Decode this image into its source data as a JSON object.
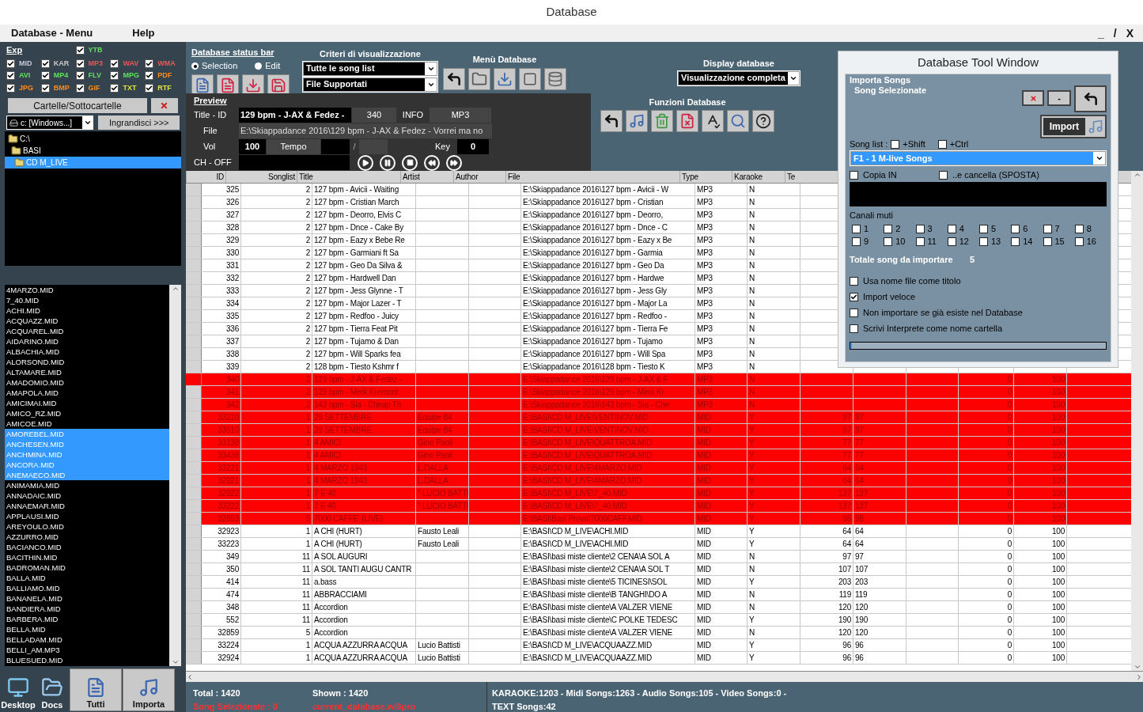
{
  "window": {
    "title": "Database",
    "controls": [
      "_",
      "/",
      "X"
    ]
  },
  "menu": [
    "Database - Menu",
    "Help"
  ],
  "formats": {
    "link": "Exp",
    "items": [
      {
        "label": "YTB",
        "color": "#5fe05f",
        "checked": true
      },
      {
        "label": "MID",
        "color": "#c8c8dc",
        "checked": true
      },
      {
        "label": "KAR",
        "color": "#c8c8c8",
        "checked": true
      },
      {
        "label": "MP3",
        "color": "#e85858",
        "checked": true
      },
      {
        "label": "WAV",
        "color": "#e85858",
        "checked": true
      },
      {
        "label": "WMA",
        "color": "#e85858",
        "checked": true
      },
      {
        "label": "AVI",
        "color": "#5fe05f",
        "checked": true
      },
      {
        "label": "MP4",
        "color": "#5fe05f",
        "checked": true
      },
      {
        "label": "FLV",
        "color": "#5fe05f",
        "checked": true
      },
      {
        "label": "MPG",
        "color": "#5fe05f",
        "checked": true
      },
      {
        "label": "PDF",
        "color": "#ff8c1a",
        "checked": true
      },
      {
        "label": "JPG",
        "color": "#ff8c1a",
        "checked": true
      },
      {
        "label": "BMP",
        "color": "#ff8c1a",
        "checked": true
      },
      {
        "label": "GIF",
        "color": "#ff8c1a",
        "checked": true
      },
      {
        "label": "TXT",
        "color": "#e0e040",
        "checked": true
      },
      {
        "label": "RTF",
        "color": "#e0e040",
        "checked": true
      }
    ]
  },
  "folders_button": "Cartelle/Sottocartelle",
  "drive": "c: [Windows...]",
  "enlarge_button": "Ingrandisci >>>",
  "tree": [
    {
      "label": "C:\\",
      "selected": false,
      "children": [
        {
          "label": "BASI",
          "selected": false,
          "children": [
            {
              "label": "CD M_LIVE",
              "selected": true
            }
          ]
        }
      ]
    }
  ],
  "files": [
    {
      "name": "4MARZO.MID",
      "selected": false
    },
    {
      "name": "7_40.MID",
      "selected": false
    },
    {
      "name": "ACHI.MID",
      "selected": false
    },
    {
      "name": "ACQUAZZ.MID",
      "selected": false
    },
    {
      "name": "ACQUAREL.MID",
      "selected": false
    },
    {
      "name": "AIDARINO.MID",
      "selected": false
    },
    {
      "name": "ALBACHIA.MID",
      "selected": false
    },
    {
      "name": "ALORSOND.MID",
      "selected": false
    },
    {
      "name": "ALTAMARE.MID",
      "selected": false
    },
    {
      "name": "AMADOMIO.MID",
      "selected": false
    },
    {
      "name": "AMAPOLA.MID",
      "selected": false
    },
    {
      "name": "AMICIMAI.MID",
      "selected": false
    },
    {
      "name": "AMICO_RZ.MID",
      "selected": false
    },
    {
      "name": "AMICOE.MID",
      "selected": false
    },
    {
      "name": "AMOREBEL.MID",
      "selected": true
    },
    {
      "name": "ANCHESEN.MID",
      "selected": true
    },
    {
      "name": "ANCHMINA.MID",
      "selected": true
    },
    {
      "name": "ANCORA.MID",
      "selected": true
    },
    {
      "name": "ANEMAECO.MID",
      "selected": true
    },
    {
      "name": "ANIMAMIA.MID",
      "selected": false
    },
    {
      "name": "ANNADAIC.MID",
      "selected": false
    },
    {
      "name": "ANNAEMAR.MID",
      "selected": false
    },
    {
      "name": "APPLAUSI.MID",
      "selected": false
    },
    {
      "name": "AREYOULO.MID",
      "selected": false
    },
    {
      "name": "AZZURRO.MID",
      "selected": false
    },
    {
      "name": "BACIANCO.MID",
      "selected": false
    },
    {
      "name": "BACITHIN.MID",
      "selected": false
    },
    {
      "name": "BADROMAN.MID",
      "selected": false
    },
    {
      "name": "BALLA.MID",
      "selected": false
    },
    {
      "name": "BALLIAMO.MID",
      "selected": false
    },
    {
      "name": "BANANELA.MID",
      "selected": false
    },
    {
      "name": "BANDIERA.MID",
      "selected": false
    },
    {
      "name": "BARBERA.MID",
      "selected": false
    },
    {
      "name": "BELLA.MID",
      "selected": false
    },
    {
      "name": "BELLADAM.MID",
      "selected": false
    },
    {
      "name": "BELLI_AM.MP3",
      "selected": false
    },
    {
      "name": "BLUESUED.MID",
      "selected": false
    }
  ],
  "bottom_buttons": [
    {
      "label": "Desktop",
      "kind": "desktop"
    },
    {
      "label": "Docs",
      "kind": "docs"
    },
    {
      "label": "Tutti",
      "kind": "all"
    },
    {
      "label": "Importa",
      "kind": "import"
    }
  ],
  "toolbar": {
    "status_link": "Database status bar",
    "modes": [
      {
        "label": "Selection",
        "selected": true
      },
      {
        "label": "Edit",
        "selected": false
      }
    ],
    "criteria_title": "Criteri di visualizzazione",
    "criteria": [
      "Tutte le song list",
      "File Supportati"
    ],
    "menu_title": "Menù Database",
    "display_title": "Display database",
    "display_value": "Visualizzazione completa",
    "functions_title": "Funzioni Database"
  },
  "preview": {
    "title": "Preview",
    "title_label": "Title - ID",
    "song": "129 bpm - J-AX & Fedez -",
    "id": "340",
    "info_label": "INFO",
    "type": "MP3",
    "file_label": "File",
    "file": "E:\\Skiappadance 2016\\129 bpm - J-AX & Fedez - Vorrei ma no",
    "vol_label": "Vol",
    "vol": "100",
    "tempo_label": "Tempo",
    "slash": "/",
    "key_label": "Key",
    "key": "0",
    "ch_label": "CH - OFF"
  },
  "table": {
    "columns": [
      "ID",
      "Songlist",
      "Title",
      "Artist",
      "Author",
      "File",
      "Type",
      "Karaoke",
      "Te"
    ],
    "rows": [
      {
        "selected": false,
        "current": false,
        "id": "325",
        "songlist": "2",
        "title": "127 bpm - Avicii - Waiting",
        "file": "E:\\Skiappadance 2016\\127 bpm - Avicii - W",
        "type": "MP3",
        "karaoke": "N"
      },
      {
        "selected": false,
        "current": false,
        "id": "326",
        "songlist": "2",
        "title": "127 bpm - Cristian March",
        "file": "E:\\Skiappadance 2016\\127 bpm - Cristian",
        "type": "MP3",
        "karaoke": "N"
      },
      {
        "selected": false,
        "current": false,
        "id": "327",
        "songlist": "2",
        "title": "127 bpm - Deorro, Elvis C",
        "file": "E:\\Skiappadance 2016\\127 bpm - Deorro,",
        "type": "MP3",
        "karaoke": "N"
      },
      {
        "selected": false,
        "current": false,
        "id": "328",
        "songlist": "2",
        "title": "127 bpm - Dnce - Cake By",
        "file": "E:\\Skiappadance 2016\\127 bpm - Dnce - C",
        "type": "MP3",
        "karaoke": "N"
      },
      {
        "selected": false,
        "current": false,
        "id": "329",
        "songlist": "2",
        "title": "127 bpm - Eazy x Bebe Re",
        "file": "E:\\Skiappadance 2016\\127 bpm - Eazy x Be",
        "type": "MP3",
        "karaoke": "N"
      },
      {
        "selected": false,
        "current": false,
        "id": "330",
        "songlist": "2",
        "title": "127 bpm - Garmiani ft Sa",
        "file": "E:\\Skiappadance 2016\\127 bpm - Garmia",
        "type": "MP3",
        "karaoke": "N"
      },
      {
        "selected": false,
        "current": false,
        "id": "331",
        "songlist": "2",
        "title": "127 bpm - Geo Da Silva &",
        "file": "E:\\Skiappadance 2016\\127 bpm - Geo Da",
        "type": "MP3",
        "karaoke": "N"
      },
      {
        "selected": false,
        "current": false,
        "id": "332",
        "songlist": "2",
        "title": "127 bpm - Hardwell Dan",
        "file": "E:\\Skiappadance 2016\\127 bpm - Hardwe",
        "type": "MP3",
        "karaoke": "N"
      },
      {
        "selected": false,
        "current": false,
        "id": "333",
        "songlist": "2",
        "title": "127 bpm - Jess Glynne - T",
        "file": "E:\\Skiappadance 2016\\127 bpm - Jess Gly",
        "type": "MP3",
        "karaoke": "N"
      },
      {
        "selected": false,
        "current": false,
        "id": "334",
        "songlist": "2",
        "title": "127 bpm - Major Lazer - T",
        "file": "E:\\Skiappadance 2016\\127 bpm - Major La",
        "type": "MP3",
        "karaoke": "N"
      },
      {
        "selected": false,
        "current": false,
        "id": "335",
        "songlist": "2",
        "title": "127 bpm - Redfoo - Juicy",
        "file": "E:\\Skiappadance 2016\\127 bpm - Redfoo -",
        "type": "MP3",
        "karaoke": "N"
      },
      {
        "selected": false,
        "current": false,
        "id": "336",
        "songlist": "2",
        "title": "127 bpm - Tierra Feat Pit",
        "file": "E:\\Skiappadance 2016\\127 bpm - Tierra Fe",
        "type": "MP3",
        "karaoke": "N"
      },
      {
        "selected": false,
        "current": false,
        "id": "337",
        "songlist": "2",
        "title": "127 bpm - Tujamo & Dan",
        "file": "E:\\Skiappadance 2016\\127 bpm - Tujamo",
        "type": "MP3",
        "karaoke": "N"
      },
      {
        "selected": false,
        "current": false,
        "id": "338",
        "songlist": "2",
        "title": "127 bpm - Will Sparks fea",
        "file": "E:\\Skiappadance 2016\\127 bpm - Will Spa",
        "type": "MP3",
        "karaoke": "N"
      },
      {
        "selected": false,
        "current": false,
        "id": "339",
        "songlist": "2",
        "title": "128 bpm - Tiesto Kshmr f",
        "file": "E:\\Skiappadance 2016\\128 bpm - Tiesto K",
        "type": "MP3",
        "karaoke": "N"
      },
      {
        "selected": true,
        "current": true,
        "id": "340",
        "songlist": "2",
        "title": "129 bpm - J-AX & Fedez -",
        "file": "E:\\Skiappadance 2016\\129 bpm - J-AX & F",
        "type": "MP3",
        "karaoke": "N",
        "column_12": "0",
        "column_13": "100"
      },
      {
        "selected": true,
        "current": false,
        "id": "341",
        "songlist": "2",
        "title": "129 bpm - Merk Kremont",
        "file": "E:\\Skiappadance 2016\\129 bpm - Merk Kr",
        "type": "MP3",
        "karaoke": "N",
        "column_12": "0",
        "column_13": "100"
      },
      {
        "selected": true,
        "current": false,
        "id": "342",
        "songlist": "2",
        "title": "143 bpm - Sia - Cheap Th",
        "file": "E:\\Skiappadance 2016\\143 bpm - Sia - Che",
        "type": "MP3",
        "karaoke": "N",
        "column_12": "0",
        "column_13": "100"
      },
      {
        "selected": true,
        "current": false,
        "id": "33210",
        "songlist": "1",
        "title": "29 SETTEMBRE",
        "artist": "Equipe 84",
        "file": "E:\\BASI\\CD M_LIVE\\VENTINOV.MID",
        "type": "MID",
        "karaoke": "Y",
        "te": "97",
        "column_10": "97",
        "column_12": "0",
        "column_13": "100"
      },
      {
        "selected": true,
        "current": false,
        "id": "33510",
        "songlist": "1",
        "title": "29 SETTEMBRE",
        "artist": "Equipe 84",
        "file": "E:\\BASI\\CD M_LIVE\\VENTINOV.MID",
        "type": "MID",
        "karaoke": "Y",
        "te": "97",
        "column_10": "97",
        "column_12": "0",
        "column_13": "100"
      },
      {
        "selected": true,
        "current": false,
        "id": "33138",
        "songlist": "1",
        "title": "4 AMICI",
        "artist": "Gino Paoli",
        "file": "E:\\BASI\\CD M_LIVE\\QUATTROA.MID",
        "type": "MID",
        "karaoke": "Y",
        "te": "77",
        "column_10": "77",
        "column_12": "0",
        "column_13": "100"
      },
      {
        "selected": true,
        "current": false,
        "id": "33438",
        "songlist": "1",
        "title": "4 AMICI",
        "artist": "Gino Paoli",
        "file": "E:\\BASI\\CD M_LIVE\\QUATTROA.MID",
        "type": "MID",
        "karaoke": "Y",
        "te": "77",
        "column_10": "77",
        "column_12": "0",
        "column_13": "100"
      },
      {
        "selected": true,
        "current": false,
        "id": "33221",
        "songlist": "1",
        "title": "4 MARZO 1943",
        "artist": "L.DALLA",
        "file": "E:\\BASI\\CD M_LIVE\\4MARZO.MID",
        "type": "MID",
        "karaoke": "Y",
        "te": "64",
        "column_10": "64",
        "column_12": "0",
        "column_13": "100"
      },
      {
        "selected": true,
        "current": false,
        "id": "32921",
        "songlist": "1",
        "title": "4 MARZO 1943",
        "artist": "L.DALLA",
        "file": "E:\\BASI\\CD M_LIVE\\4MARZO.MID",
        "type": "MID",
        "karaoke": "Y",
        "te": "64",
        "column_10": "64",
        "column_12": "0",
        "column_13": "100"
      },
      {
        "selected": true,
        "current": false,
        "id": "32922",
        "songlist": "1",
        "title": "7 E 40",
        "artist": "\" LUCIO BATTI",
        "file": "E:\\BASI\\CD M_LIVE\\7_40.MID",
        "type": "MID",
        "karaoke": "Y",
        "te": "137",
        "column_10": "137",
        "column_12": "0",
        "column_13": "100"
      },
      {
        "selected": true,
        "current": false,
        "id": "33222",
        "songlist": "1",
        "title": "7 E 40",
        "artist": "\" LUCIO BATTI",
        "file": "E:\\BASI\\CD M_LIVE\\7_40.MID",
        "type": "MID",
        "karaoke": "Y",
        "te": "137",
        "column_10": "137",
        "column_12": "0",
        "column_13": "100"
      },
      {
        "selected": true,
        "current": false,
        "id": "32853",
        "songlist": "5",
        "title": "7000 CAFFE' (LIVE)",
        "file": "E:\\BASI\\Basi Prova\\7000CAFF.MID",
        "type": "MID",
        "karaoke": "Y",
        "te": "98",
        "column_10": "98",
        "column_12": "0",
        "column_13": "100"
      },
      {
        "selected": false,
        "current": false,
        "id": "32923",
        "songlist": "1",
        "title": "A CHI (HURT)",
        "artist": "Fausto Leali",
        "file": "E:\\BASI\\CD M_LIVE\\ACHI.MID",
        "type": "MID",
        "karaoke": "Y",
        "te": "64",
        "column_10": "64",
        "column_12": "0",
        "column_13": "100"
      },
      {
        "selected": false,
        "current": false,
        "id": "33223",
        "songlist": "1",
        "title": "A CHI (HURT)",
        "artist": "Fausto Leali",
        "file": "E:\\BASI\\CD M_LIVE\\ACHI.MID",
        "type": "MID",
        "karaoke": "Y",
        "te": "64",
        "column_10": "64",
        "column_12": "0",
        "column_13": "100"
      },
      {
        "selected": false,
        "current": false,
        "id": "349",
        "songlist": "11",
        "title": "A SOL AUGURI",
        "file": "E:\\BASI\\basi miste cliente\\2 CENA\\A SOL A",
        "type": "MID",
        "karaoke": "N",
        "te": "97",
        "column_10": "97",
        "column_12": "0",
        "column_13": "100"
      },
      {
        "selected": false,
        "current": false,
        "id": "350",
        "songlist": "11",
        "title": "A SOL TANTI AUGU CANTR",
        "file": "E:\\BASI\\basi miste cliente\\2 CENA\\A SOL T",
        "type": "MID",
        "karaoke": "N",
        "te": "107",
        "column_10": "107",
        "column_12": "0",
        "column_13": "100"
      },
      {
        "selected": false,
        "current": false,
        "id": "414",
        "songlist": "11",
        "title": "a.bass",
        "file": "E:\\BASI\\basi miste cliente\\5 TICINESI\\SOL",
        "type": "MID",
        "karaoke": "Y",
        "te": "203",
        "column_10": "203",
        "column_12": "0",
        "column_13": "100"
      },
      {
        "selected": false,
        "current": false,
        "id": "474",
        "songlist": "11",
        "title": "ABBRACCIAMI",
        "file": "E:\\BASI\\basi miste cliente\\B TANGHI\\DO A",
        "type": "MID",
        "karaoke": "N",
        "te": "119",
        "column_10": "119",
        "column_12": "0",
        "column_13": "100"
      },
      {
        "selected": false,
        "current": false,
        "id": "348",
        "songlist": "11",
        "title": "Accordion",
        "file": "E:\\BASI\\basi miste cliente\\A VALZER VIENE",
        "type": "MID",
        "karaoke": "N",
        "te": "120",
        "column_10": "120",
        "column_12": "0",
        "column_13": "100"
      },
      {
        "selected": false,
        "current": false,
        "id": "552",
        "songlist": "11",
        "title": "Accordion",
        "file": "E:\\BASI\\basi miste cliente\\C POLKE TEDESC",
        "type": "MID",
        "karaoke": "Y",
        "te": "190",
        "column_10": "190",
        "column_12": "0",
        "column_13": "100"
      },
      {
        "selected": false,
        "current": false,
        "id": "32859",
        "songlist": "5",
        "title": "Accordion",
        "file": "E:\\BASI\\basi miste cliente\\A VALZER VIENE",
        "type": "MID",
        "karaoke": "N",
        "te": "120",
        "column_10": "120",
        "column_12": "0",
        "column_13": "100"
      },
      {
        "selected": false,
        "current": false,
        "id": "33224",
        "songlist": "1",
        "title": "ACQUA AZZURRA ACQUA",
        "artist": "Lucio Battisti",
        "file": "E:\\BASI\\CD M_LIVE\\ACQUAAZZ.MID",
        "type": "MID",
        "karaoke": "Y",
        "te": "96",
        "column_10": "96",
        "column_12": "0",
        "column_13": "100"
      },
      {
        "selected": false,
        "current": false,
        "id": "32924",
        "songlist": "1",
        "title": "ACQUA AZZURRA ACQUA",
        "artist": "Lucio Battisti",
        "file": "E:\\BASI\\CD M_LIVE\\ACQUAAZZ.MID",
        "type": "MID",
        "karaoke": "Y",
        "te": "96",
        "column_10": "96",
        "column_12": "0",
        "column_13": "100"
      }
    ]
  },
  "tool_window": {
    "title": "Database Tool Window",
    "group": "Importa Songs",
    "subtitle": "Song Selezionate",
    "minus": "-",
    "import": "Import",
    "song_list_label": "Song list :",
    "modifiers": [
      {
        "label": "+Shift",
        "checked": false
      },
      {
        "label": "+Ctrl",
        "checked": false
      }
    ],
    "song_list": "F1 - 1 M-live Songs",
    "copy": [
      {
        "label": "Copia IN",
        "checked": false
      },
      {
        "label": "..e cancella (SPOSTA)",
        "checked": false
      }
    ],
    "channels_label": "Canali muti",
    "channels": [
      {
        "label": "1",
        "checked": false
      },
      {
        "label": "2",
        "checked": false
      },
      {
        "label": "3",
        "checked": false
      },
      {
        "label": "4",
        "checked": false
      },
      {
        "label": "5",
        "checked": false
      },
      {
        "label": "6",
        "checked": false
      },
      {
        "label": "7",
        "checked": false
      },
      {
        "label": "8",
        "checked": false
      },
      {
        "label": "9",
        "checked": false
      },
      {
        "label": "10",
        "checked": false
      },
      {
        "label": "11",
        "checked": false
      },
      {
        "label": "12",
        "checked": false
      },
      {
        "label": "13",
        "checked": false
      },
      {
        "label": "14",
        "checked": false
      },
      {
        "label": "15",
        "checked": false
      },
      {
        "label": "16",
        "checked": false
      }
    ],
    "total_label": "Totale song da importare",
    "total": "5",
    "options": [
      {
        "label": "Usa nome file come titolo",
        "checked": false
      },
      {
        "label": "Import veloce",
        "checked": true
      },
      {
        "label": "Non importare se già esiste nel Database",
        "checked": false
      },
      {
        "label": "Scrivi Interprete come nome cartella",
        "checked": false
      }
    ],
    "progress": {
      "level": 0
    }
  },
  "status": {
    "total": "Total : 1420",
    "selected": "Song Selezionate : 0",
    "shown": "Shown : 1420",
    "database": "current_database.wl6pro",
    "summary": "KARAOKE:1203 - Midi Songs:1263 - Audio Songs:105 - Video Songs:0 - TEXT Songs:42"
  }
}
